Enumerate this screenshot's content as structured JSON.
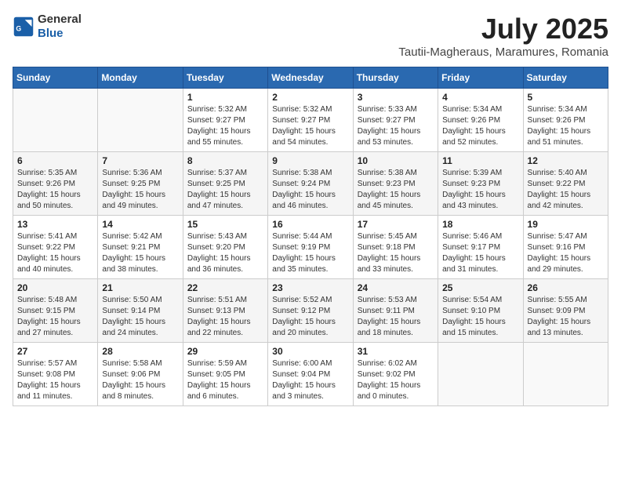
{
  "header": {
    "logo_general": "General",
    "logo_blue": "Blue",
    "title": "July 2025",
    "subtitle": "Tautii-Magheraus, Maramures, Romania"
  },
  "weekdays": [
    "Sunday",
    "Monday",
    "Tuesday",
    "Wednesday",
    "Thursday",
    "Friday",
    "Saturday"
  ],
  "weeks": [
    [
      {
        "day": "",
        "info": ""
      },
      {
        "day": "",
        "info": ""
      },
      {
        "day": "1",
        "info": "Sunrise: 5:32 AM\nSunset: 9:27 PM\nDaylight: 15 hours and 55 minutes."
      },
      {
        "day": "2",
        "info": "Sunrise: 5:32 AM\nSunset: 9:27 PM\nDaylight: 15 hours and 54 minutes."
      },
      {
        "day": "3",
        "info": "Sunrise: 5:33 AM\nSunset: 9:27 PM\nDaylight: 15 hours and 53 minutes."
      },
      {
        "day": "4",
        "info": "Sunrise: 5:34 AM\nSunset: 9:26 PM\nDaylight: 15 hours and 52 minutes."
      },
      {
        "day": "5",
        "info": "Sunrise: 5:34 AM\nSunset: 9:26 PM\nDaylight: 15 hours and 51 minutes."
      }
    ],
    [
      {
        "day": "6",
        "info": "Sunrise: 5:35 AM\nSunset: 9:26 PM\nDaylight: 15 hours and 50 minutes."
      },
      {
        "day": "7",
        "info": "Sunrise: 5:36 AM\nSunset: 9:25 PM\nDaylight: 15 hours and 49 minutes."
      },
      {
        "day": "8",
        "info": "Sunrise: 5:37 AM\nSunset: 9:25 PM\nDaylight: 15 hours and 47 minutes."
      },
      {
        "day": "9",
        "info": "Sunrise: 5:38 AM\nSunset: 9:24 PM\nDaylight: 15 hours and 46 minutes."
      },
      {
        "day": "10",
        "info": "Sunrise: 5:38 AM\nSunset: 9:23 PM\nDaylight: 15 hours and 45 minutes."
      },
      {
        "day": "11",
        "info": "Sunrise: 5:39 AM\nSunset: 9:23 PM\nDaylight: 15 hours and 43 minutes."
      },
      {
        "day": "12",
        "info": "Sunrise: 5:40 AM\nSunset: 9:22 PM\nDaylight: 15 hours and 42 minutes."
      }
    ],
    [
      {
        "day": "13",
        "info": "Sunrise: 5:41 AM\nSunset: 9:22 PM\nDaylight: 15 hours and 40 minutes."
      },
      {
        "day": "14",
        "info": "Sunrise: 5:42 AM\nSunset: 9:21 PM\nDaylight: 15 hours and 38 minutes."
      },
      {
        "day": "15",
        "info": "Sunrise: 5:43 AM\nSunset: 9:20 PM\nDaylight: 15 hours and 36 minutes."
      },
      {
        "day": "16",
        "info": "Sunrise: 5:44 AM\nSunset: 9:19 PM\nDaylight: 15 hours and 35 minutes."
      },
      {
        "day": "17",
        "info": "Sunrise: 5:45 AM\nSunset: 9:18 PM\nDaylight: 15 hours and 33 minutes."
      },
      {
        "day": "18",
        "info": "Sunrise: 5:46 AM\nSunset: 9:17 PM\nDaylight: 15 hours and 31 minutes."
      },
      {
        "day": "19",
        "info": "Sunrise: 5:47 AM\nSunset: 9:16 PM\nDaylight: 15 hours and 29 minutes."
      }
    ],
    [
      {
        "day": "20",
        "info": "Sunrise: 5:48 AM\nSunset: 9:15 PM\nDaylight: 15 hours and 27 minutes."
      },
      {
        "day": "21",
        "info": "Sunrise: 5:50 AM\nSunset: 9:14 PM\nDaylight: 15 hours and 24 minutes."
      },
      {
        "day": "22",
        "info": "Sunrise: 5:51 AM\nSunset: 9:13 PM\nDaylight: 15 hours and 22 minutes."
      },
      {
        "day": "23",
        "info": "Sunrise: 5:52 AM\nSunset: 9:12 PM\nDaylight: 15 hours and 20 minutes."
      },
      {
        "day": "24",
        "info": "Sunrise: 5:53 AM\nSunset: 9:11 PM\nDaylight: 15 hours and 18 minutes."
      },
      {
        "day": "25",
        "info": "Sunrise: 5:54 AM\nSunset: 9:10 PM\nDaylight: 15 hours and 15 minutes."
      },
      {
        "day": "26",
        "info": "Sunrise: 5:55 AM\nSunset: 9:09 PM\nDaylight: 15 hours and 13 minutes."
      }
    ],
    [
      {
        "day": "27",
        "info": "Sunrise: 5:57 AM\nSunset: 9:08 PM\nDaylight: 15 hours and 11 minutes."
      },
      {
        "day": "28",
        "info": "Sunrise: 5:58 AM\nSunset: 9:06 PM\nDaylight: 15 hours and 8 minutes."
      },
      {
        "day": "29",
        "info": "Sunrise: 5:59 AM\nSunset: 9:05 PM\nDaylight: 15 hours and 6 minutes."
      },
      {
        "day": "30",
        "info": "Sunrise: 6:00 AM\nSunset: 9:04 PM\nDaylight: 15 hours and 3 minutes."
      },
      {
        "day": "31",
        "info": "Sunrise: 6:02 AM\nSunset: 9:02 PM\nDaylight: 15 hours and 0 minutes."
      },
      {
        "day": "",
        "info": ""
      },
      {
        "day": "",
        "info": ""
      }
    ]
  ]
}
